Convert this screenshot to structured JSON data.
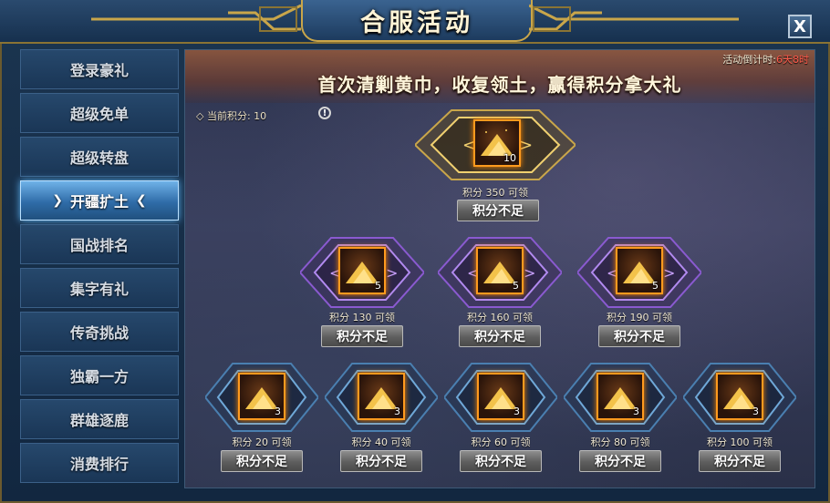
{
  "window": {
    "title": "合服活动",
    "close_label": "X"
  },
  "sidebar": {
    "items": [
      {
        "label": "登录豪礼",
        "active": false
      },
      {
        "label": "超级免单",
        "active": false
      },
      {
        "label": "超级转盘",
        "active": false
      },
      {
        "label": "开疆扩土",
        "active": true
      },
      {
        "label": "国战排名",
        "active": false
      },
      {
        "label": "集字有礼",
        "active": false
      },
      {
        "label": "传奇挑战",
        "active": false
      },
      {
        "label": "独霸一方",
        "active": false
      },
      {
        "label": "群雄逐鹿",
        "active": false
      },
      {
        "label": "消费排行",
        "active": false
      }
    ]
  },
  "banner": {
    "headline": "首次清剿黄巾，收复领土，赢得积分拿大礼",
    "countdown_label": "活动倒计时:",
    "countdown_value": "6天8时"
  },
  "status": {
    "points_label": "◇ 当前积分: 10",
    "info_icon": "!"
  },
  "rewards": {
    "tier1": [
      {
        "qty": "10",
        "points_text": "积分  350  可领",
        "button": "积分不足"
      }
    ],
    "tier2": [
      {
        "qty": "5",
        "points_text": "积分  130  可领",
        "button": "积分不足"
      },
      {
        "qty": "5",
        "points_text": "积分  160  可领",
        "button": "积分不足"
      },
      {
        "qty": "5",
        "points_text": "积分  190  可领",
        "button": "积分不足"
      }
    ],
    "tier3": [
      {
        "qty": "3",
        "points_text": "积分  20  可领",
        "button": "积分不足"
      },
      {
        "qty": "3",
        "points_text": "积分  40  可领",
        "button": "积分不足"
      },
      {
        "qty": "3",
        "points_text": "积分  60  可领",
        "button": "积分不足"
      },
      {
        "qty": "3",
        "points_text": "积分  80  可领",
        "button": "积分不足"
      },
      {
        "qty": "3",
        "points_text": "积分  100  可领",
        "button": "积分不足"
      }
    ]
  },
  "colors": {
    "gold_frame": "#c9a64a",
    "purple_frame": "#8a5ad0",
    "blue_frame": "#4a7fb0",
    "countdown_value": "#ff5a4a",
    "item_glow": "#ff9a1e"
  },
  "icons": {
    "item": "gold-pile-icon",
    "close": "close-icon",
    "info": "info-icon",
    "arrow": "chevron-icon"
  }
}
